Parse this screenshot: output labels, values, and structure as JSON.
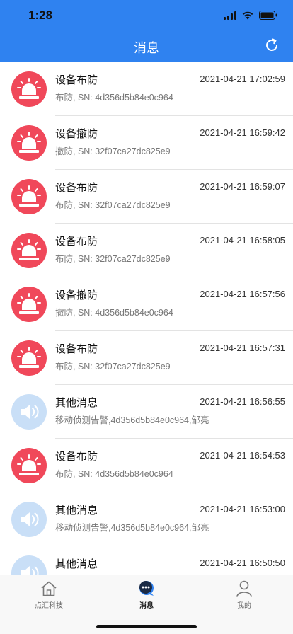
{
  "status": {
    "time": "1:28"
  },
  "nav": {
    "title": "消息"
  },
  "messages": [
    {
      "title": "设备布防",
      "time": "2021-04-21 17:02:59",
      "subtitle": "布防, SN: 4d356d5b84e0c964",
      "kind": "alarm"
    },
    {
      "title": "设备撤防",
      "time": "2021-04-21 16:59:42",
      "subtitle": "撤防, SN: 32f07ca27dc825e9",
      "kind": "alarm"
    },
    {
      "title": "设备布防",
      "time": "2021-04-21 16:59:07",
      "subtitle": "布防, SN: 32f07ca27dc825e9",
      "kind": "alarm"
    },
    {
      "title": "设备布防",
      "time": "2021-04-21 16:58:05",
      "subtitle": "布防, SN: 32f07ca27dc825e9",
      "kind": "alarm"
    },
    {
      "title": "设备撤防",
      "time": "2021-04-21 16:57:56",
      "subtitle": "撤防, SN: 4d356d5b84e0c964",
      "kind": "alarm"
    },
    {
      "title": "设备布防",
      "time": "2021-04-21 16:57:31",
      "subtitle": "布防, SN: 32f07ca27dc825e9",
      "kind": "alarm"
    },
    {
      "title": "其他消息",
      "time": "2021-04-21 16:56:55",
      "subtitle": "移动侦测告警,4d356d5b84e0c964,邹亮",
      "kind": "message"
    },
    {
      "title": "设备布防",
      "time": "2021-04-21 16:54:53",
      "subtitle": "布防, SN: 4d356d5b84e0c964",
      "kind": "alarm"
    },
    {
      "title": "其他消息",
      "time": "2021-04-21 16:53:00",
      "subtitle": "移动侦测告警,4d356d5b84e0c964,邹亮",
      "kind": "message"
    },
    {
      "title": "其他消息",
      "time": "2021-04-21 16:50:50",
      "subtitle": "",
      "kind": "message"
    }
  ],
  "tabs": [
    {
      "label": "点汇科技",
      "icon": "home-icon"
    },
    {
      "label": "消息",
      "icon": "chat-icon"
    },
    {
      "label": "我的",
      "icon": "user-icon"
    }
  ],
  "colors": {
    "brand": "#2f82f0",
    "alarm": "#f0485a",
    "message": "#c9dff7"
  }
}
